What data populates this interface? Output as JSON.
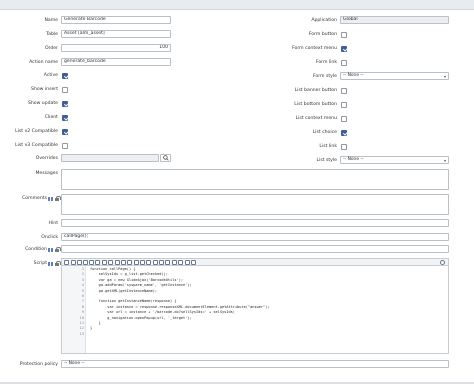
{
  "form": {
    "name_label": "Name",
    "name_value": "Generate Barcode",
    "table_label": "Table",
    "table_value": "Asset [alm_asset]",
    "order_label": "Order",
    "order_value": "100",
    "action_name_label": "Action name",
    "action_name_value": "generate_barcode",
    "active_label": "Active",
    "active_checked": true,
    "show_insert_label": "Show insert",
    "show_insert_checked": false,
    "show_update_label": "Show update",
    "show_update_checked": true,
    "client_label": "Client",
    "client_checked": true,
    "list_v2_label": "List v2 Compatible",
    "list_v2_checked": true,
    "list_v3_label": "List v3 Compatible",
    "list_v3_checked": false,
    "overrides_label": "Overrides",
    "overrides_value": "",
    "messages_label": "Messages",
    "comments_label": "Comments",
    "hint_label": "Hint",
    "onclick_label": "Onclick",
    "onclick_value": "callPage();",
    "condition_label": "Condition",
    "script_label": "Script",
    "protection_label": "Protection policy",
    "protection_value": "-- None --"
  },
  "right": {
    "application_label": "Application",
    "application_value": "Global",
    "form_button_label": "Form button",
    "form_button_checked": false,
    "form_context_label": "Form context menu",
    "form_context_checked": true,
    "form_link_label": "Form link",
    "form_link_checked": false,
    "form_style_label": "Form style",
    "form_style_value": "-- None --",
    "list_banner_label": "List banner button",
    "list_banner_checked": false,
    "list_bottom_label": "List bottom button",
    "list_bottom_checked": false,
    "list_context_label": "List context menu",
    "list_context_checked": false,
    "list_choice_label": "List choice",
    "list_choice_checked": true,
    "list_link_label": "List link",
    "list_link_checked": false,
    "list_style_label": "List style",
    "list_style_value": "-- None --"
  },
  "script": {
    "lines": [
      "function callPage() {",
      "    selSysIds = g_list.getChecked();",
      "    var ga = new GlideAjax('BarcodeUtils');",
      "    ga.addParam('sysparm_name', 'getInstance');",
      "    ga.getXML(getInstanceName);",
      "",
      "    function getInstanceName(response) {",
      "        var instance = response.responseXML.documentElement.getAttribute(\"answer\");",
      "        var url = instance + '/barcode.do?sellSysIds=' + selSysIds;",
      "        g_navigation.openPopup(url, '_target');",
      "    }",
      "}",
      ""
    ],
    "line_numbers": [
      "1",
      "2",
      "3",
      "4",
      "5",
      "6",
      "7",
      "8",
      "9",
      "10",
      "11",
      "12",
      "13"
    ]
  },
  "icons": {
    "search": "search-icon",
    "book": "book-icon",
    "lock": "lock-icon"
  },
  "colors": {
    "accent": "#3f5f99",
    "field_border": "#b9c0c8",
    "topbar": "#e8ebf0"
  }
}
